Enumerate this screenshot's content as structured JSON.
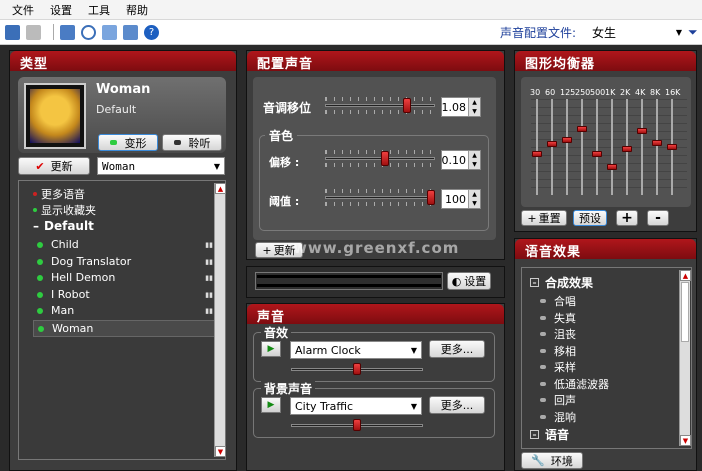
{
  "menu": [
    "文件",
    "设置",
    "工具",
    "帮助"
  ],
  "toolbar": {
    "icons": [
      "new-icon",
      "disk-icon",
      "export-icon",
      "timer-icon",
      "wave-icon",
      "image-icon",
      "help-icon"
    ],
    "profile_label": "声音配置文件:",
    "profile_value": "女生",
    "filter_icon": "filter-icon"
  },
  "type_panel": {
    "title": "类型",
    "voice_name": "Woman",
    "voice_preset": "Default",
    "morph_button": "变形",
    "listen_button": "聆听",
    "update_button": "更新",
    "voice_select": "Woman",
    "list": {
      "more_voices": "更多语音",
      "show_favorites": "显示收藏夹",
      "group": "Default",
      "items": [
        "Child",
        "Dog Translator",
        "Hell Demon",
        "I Robot",
        "Man",
        "Woman"
      ]
    }
  },
  "config_panel": {
    "title": "配置声音",
    "pitch_label": "音调移位",
    "pitch_value": "1.08",
    "pitch_level": 0.76,
    "timbre_group": "音色",
    "offset_label": "偏移 :",
    "offset_value": "0.10",
    "offset_level": 0.55,
    "threshold_label": "阈值 :",
    "threshold_value": "100",
    "threshold_level": 1.0,
    "update_button": "更新",
    "watermark": "www.greenxf.com"
  },
  "level_panel": {
    "settings_button": "设置"
  },
  "sound_panel": {
    "title": "声音",
    "effects_group": "音效",
    "effect_select": "Alarm Clock",
    "effect_more": "更多...",
    "effect_volume": 0.5,
    "background_group": "背景声音",
    "background_select": "City Traffic",
    "background_more": "更多...",
    "background_volume": 0.5
  },
  "eq_panel": {
    "title": "图形均衡器",
    "bands": [
      "30",
      "60",
      "125",
      "250",
      "500",
      "1K",
      "2K",
      "4K",
      "8K",
      "16K"
    ],
    "levels": [
      0.42,
      0.53,
      0.58,
      0.7,
      0.42,
      0.28,
      0.48,
      0.68,
      0.55,
      0.5
    ],
    "reset_button": "重置",
    "preset_button": "预设",
    "add_button": "+",
    "remove_button": "-"
  },
  "effects_panel": {
    "title": "语音效果",
    "group1": "合成效果",
    "items": [
      "合唱",
      "失真",
      "沮丧",
      "移相",
      "采样",
      "低通滤波器",
      "回声",
      "混响"
    ],
    "group2": "语音",
    "env_button": "环境"
  },
  "colors": {
    "accent_red": "#b0161b",
    "panel_bg": "#3d3d3d",
    "green_dot": "#2ecc40"
  }
}
